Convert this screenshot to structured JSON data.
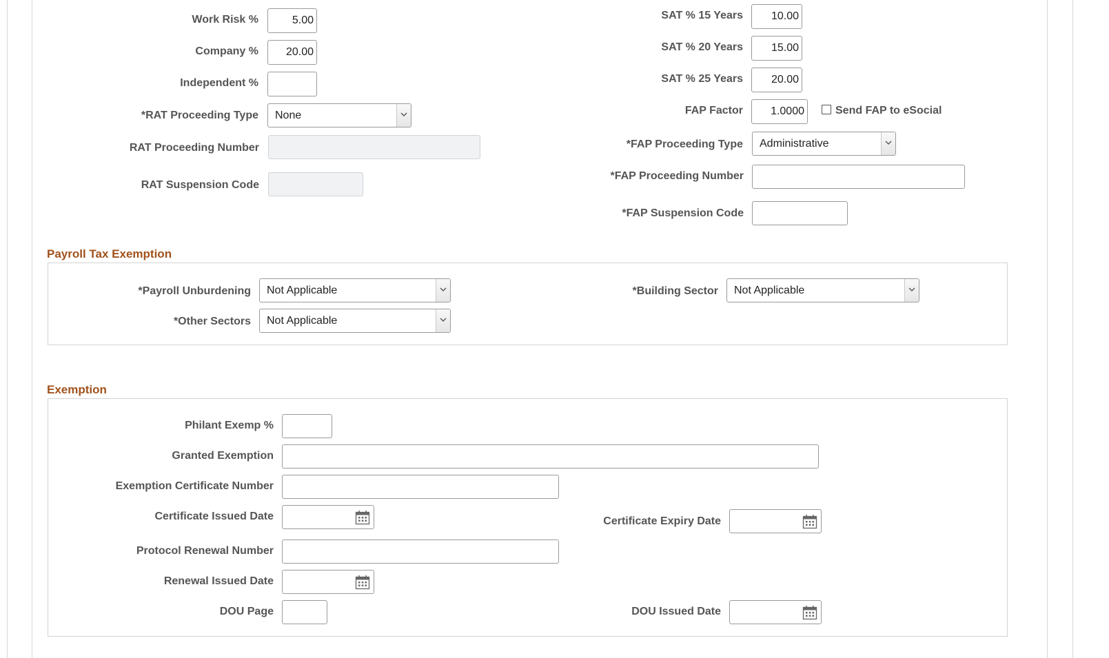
{
  "top_left": {
    "work_risk": {
      "label": "Work Risk %",
      "value": "5.00"
    },
    "company": {
      "label": "Company %",
      "value": "20.00"
    },
    "independent": {
      "label": "Independent %",
      "value": ""
    },
    "rat_proceeding_type": {
      "label": "*RAT Proceeding Type",
      "value": "None"
    },
    "rat_proceeding_number": {
      "label": "RAT Proceeding Number",
      "value": ""
    },
    "rat_suspension_code": {
      "label": "RAT Suspension Code",
      "value": ""
    }
  },
  "top_right": {
    "sat_15": {
      "label": "SAT % 15 Years",
      "value": "10.00"
    },
    "sat_20": {
      "label": "SAT % 20 Years",
      "value": "15.00"
    },
    "sat_25": {
      "label": "SAT % 25 Years",
      "value": "20.00"
    },
    "fap_factor": {
      "label": "FAP Factor",
      "value": "1.0000"
    },
    "send_fap": {
      "label": "Send FAP to eSocial",
      "checked": false
    },
    "fap_proceeding_type": {
      "label": "*FAP Proceeding Type",
      "value": "Administrative"
    },
    "fap_proceeding_number": {
      "label": "*FAP Proceeding Number",
      "value": ""
    },
    "fap_suspension_code": {
      "label": "*FAP Suspension Code",
      "value": ""
    }
  },
  "payroll_tax_exemption": {
    "title": "Payroll Tax Exemption",
    "payroll_unburdening": {
      "label": "*Payroll Unburdening",
      "value": "Not Applicable"
    },
    "other_sectors": {
      "label": "*Other Sectors",
      "value": "Not Applicable"
    },
    "building_sector": {
      "label": "*Building Sector",
      "value": "Not Applicable"
    }
  },
  "exemption": {
    "title": "Exemption",
    "philant_exemp": {
      "label": "Philant Exemp %",
      "value": ""
    },
    "granted_exemption": {
      "label": "Granted Exemption",
      "value": ""
    },
    "exemption_certificate_number": {
      "label": "Exemption Certificate Number",
      "value": ""
    },
    "certificate_issued_date": {
      "label": "Certificate Issued Date",
      "value": ""
    },
    "certificate_expiry_date": {
      "label": "Certificate Expiry Date",
      "value": ""
    },
    "protocol_renewal_number": {
      "label": "Protocol Renewal Number",
      "value": ""
    },
    "renewal_issued_date": {
      "label": "Renewal Issued Date",
      "value": ""
    },
    "dou_page": {
      "label": "DOU Page",
      "value": ""
    },
    "dou_issued_date": {
      "label": "DOU Issued Date",
      "value": ""
    }
  },
  "icons": {
    "calendar": "calendar-icon",
    "dropdown": "chevron-down-icon"
  },
  "colors": {
    "section_title": "#a0521c",
    "label": "#555555",
    "border": "#9a9a9a"
  }
}
